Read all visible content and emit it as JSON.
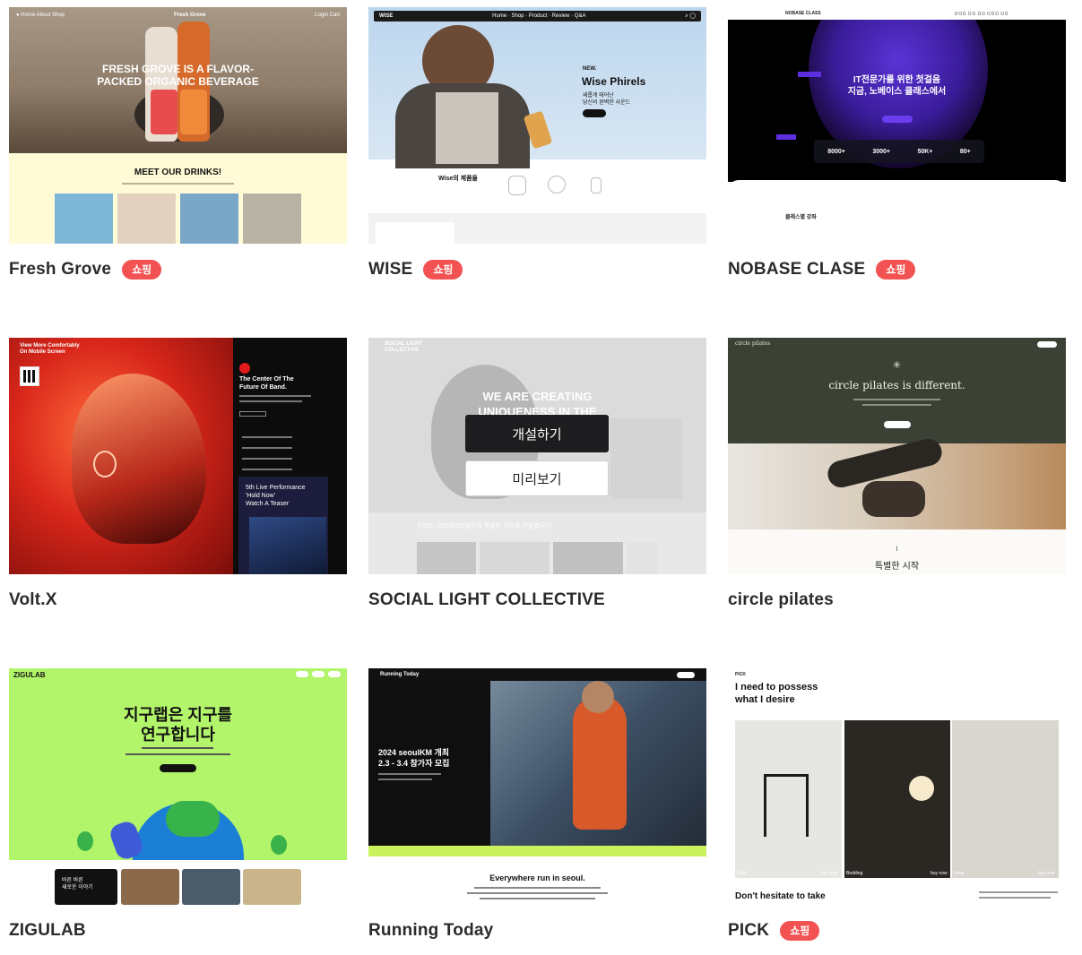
{
  "cards": [
    {
      "title": "Fresh Grove",
      "badge": "쇼핑",
      "preview": {
        "nav_logo": "Fresh Grove",
        "headline": "FRESH GROVE IS A FLAVOR-PACKED ORGANIC BEVERAGE",
        "section_title": "MEET OUR DRINKS!"
      }
    },
    {
      "title": "WISE",
      "badge": "쇼핑",
      "preview": {
        "nav_logo": "WISE",
        "eyebrow": "NEW.",
        "headline": "Wise Phirels",
        "subline_1": "새롭게 태어난",
        "subline_2": "당신의 완벽한 사운드",
        "section_title": "Wise의 제품들"
      }
    },
    {
      "title": "NOBASE CLASE",
      "badge": "쇼핑",
      "preview": {
        "nav_logo": "NOBASE CLASS",
        "headline_1": "IT전문가를 위한 첫걸음",
        "headline_2": "지금, 노베이스 클래스에서",
        "stats": [
          {
            "value": "8000+"
          },
          {
            "value": "3000+"
          },
          {
            "value": "50K+"
          },
          {
            "value": "80+"
          }
        ],
        "section_title": "클래스별 강좌"
      }
    },
    {
      "title": "Volt.X",
      "badge": "",
      "preview": {
        "corner_text_1": "View More Comfortably",
        "corner_text_2": "On Mobile Screen",
        "headline_1": "The Center Of The",
        "headline_2": "Future Of Band.",
        "promo_1": "5th Live Performance",
        "promo_2": "'Hold Now'",
        "promo_3": "Watch A Teaser"
      }
    },
    {
      "title": "SOCIAL LIGHT COLLECTIVE",
      "badge": "",
      "preview": {
        "nav_logo_1": "SOCIAL LIGHT",
        "nav_logo_2": "COLLECTIVE",
        "headline_1": "WE ARE CREATING",
        "headline_2": "UNIQUENESS IN THE",
        "body": "우리는 크리에이터들만의 특별한 가치를 전달합니다.",
        "open_button": "개설하기",
        "preview_button": "미리보기"
      }
    },
    {
      "title": "circle pilates",
      "badge": "",
      "preview": {
        "nav_logo": "circle pilates",
        "headline": "circle pilates is different.",
        "section_title": "특별한 시작"
      }
    },
    {
      "title": "ZIGULAB",
      "badge": "",
      "preview": {
        "nav_logo": "ZIGULAB",
        "headline_1": "지구랩은 지구를",
        "headline_2": "연구합니다",
        "tile_1": "바른 바른",
        "tile_2": "새로운 이야기"
      }
    },
    {
      "title": "Running Today",
      "badge": "",
      "preview": {
        "nav_logo": "Running Today",
        "headline_1": "2024 seoulKM 개최",
        "headline_2": "2.3 - 3.4 참가자 모집",
        "section_title": "Everywhere run in seoul."
      }
    },
    {
      "title": "PICK",
      "badge": "쇼핑",
      "preview": {
        "nav_logo": "PICK",
        "headline_1": "I need to possess",
        "headline_2": "what I desire",
        "photo_labels": [
          "Stool",
          "Bedding",
          "Keep"
        ],
        "buy_label": "buy now",
        "section_title": "Don't hesitate to take"
      }
    }
  ],
  "colors": {
    "badge": "#f25252",
    "title": "#2b2b2b",
    "dark_button": "#1d1d1f"
  }
}
